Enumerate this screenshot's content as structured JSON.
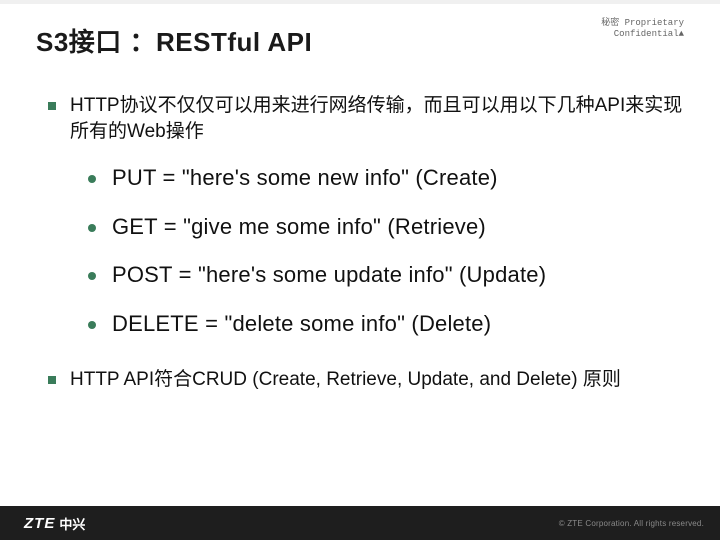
{
  "header": {
    "title": "S3接口 ：RESTful API",
    "confidential_line1": "秘密   Proprietary",
    "confidential_line2": "Confidential▲"
  },
  "body": {
    "para1": "HTTP协议不仅仅可以用来进行网络传输，而且可以用以下几种API来实现所有的Web操作",
    "methods": [
      "PUT = \"here's some new info\" (Create)",
      "GET = \"give me some info\" (Retrieve)",
      "POST = \"here's some update info\" (Update)",
      "DELETE = \"delete some info\" (Delete)"
    ],
    "para2": "HTTP API符合CRUD (Create, Retrieve, Update, and Delete) 原则"
  },
  "footer": {
    "logo_text": "ZTE",
    "logo_cn": "中兴",
    "copyright": "© ZTE Corporation. All rights reserved."
  },
  "colors": {
    "bullet": "#3a7c5a",
    "footer_bg": "#1e1e1e"
  }
}
